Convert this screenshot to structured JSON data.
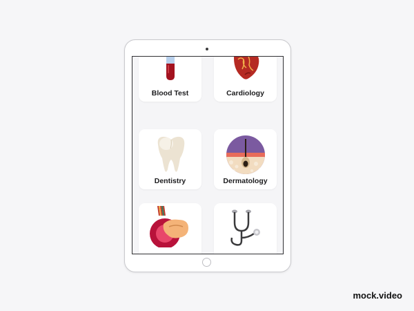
{
  "services": [
    {
      "label": "Blood Test",
      "icon": "blood-test-tube-icon"
    },
    {
      "label": "Cardiology",
      "icon": "anatomical-heart-icon"
    },
    {
      "label": "Dentistry",
      "icon": "tooth-icon"
    },
    {
      "label": "Dermatology",
      "icon": "skin-hair-follicle-icon"
    },
    {
      "label": "",
      "icon": "stomach-organ-icon"
    },
    {
      "label": "",
      "icon": "stethoscope-icon"
    }
  ],
  "watermark": "mock.video",
  "colors": {
    "background": "#f6f6f8",
    "screen": "#f5f5f7",
    "card": "#ffffff",
    "blood": "#a3121f",
    "heart": "#b52a23",
    "tooth": "#ece3d2",
    "skin_purple": "#7b5aa0"
  }
}
